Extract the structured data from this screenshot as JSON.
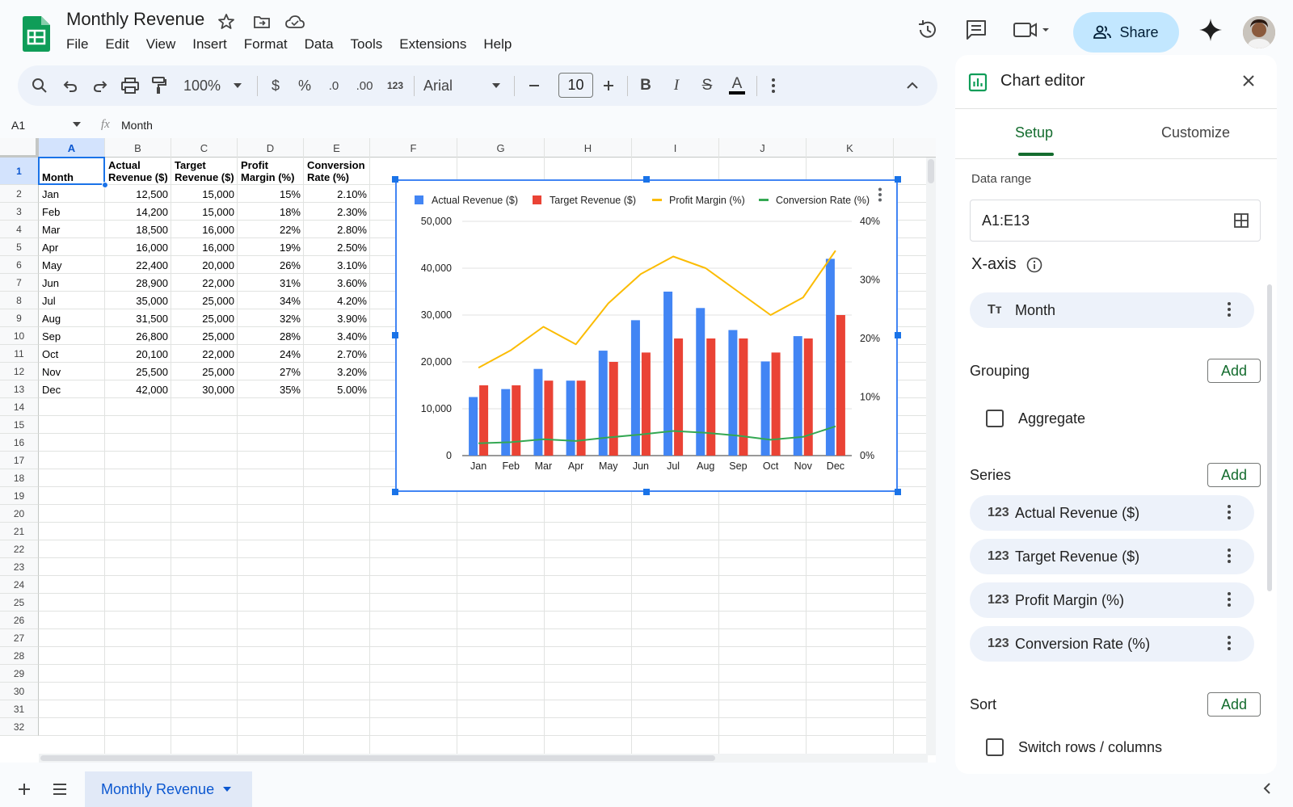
{
  "app": {
    "title": "Monthly Revenue",
    "menu": [
      "File",
      "Edit",
      "View",
      "Insert",
      "Format",
      "Data",
      "Tools",
      "Extensions",
      "Help"
    ],
    "share_label": "Share"
  },
  "toolbar": {
    "zoom": "100%",
    "currency": "$",
    "percent": "%",
    "dec_decrease": ".0",
    "dec_increase": ".00",
    "number_format": "123",
    "font": "Arial",
    "font_size": "10",
    "bold": "B",
    "italic": "I",
    "strike": "S",
    "text_color": "A"
  },
  "formula_bar": {
    "name_box": "A1",
    "fx": "fx",
    "value": "Month"
  },
  "sheet": {
    "columns": [
      "A",
      "B",
      "C",
      "D",
      "E",
      "F",
      "G",
      "H",
      "I",
      "J",
      "K"
    ],
    "row_numbers": [
      "1",
      "2",
      "3",
      "4",
      "5",
      "6",
      "7",
      "8",
      "9",
      "10",
      "11",
      "12",
      "13",
      "14",
      "15",
      "16",
      "17",
      "18",
      "19",
      "20",
      "21",
      "22",
      "23",
      "24",
      "25",
      "26",
      "27",
      "28",
      "29",
      "30",
      "31",
      "32"
    ],
    "headers": [
      "Month",
      "Actual Revenue ($)",
      "Target Revenue ($)",
      "Profit Margin (%)",
      "Conversion Rate (%)"
    ],
    "rows": [
      [
        "Jan",
        "12,500",
        "15,000",
        "15%",
        "2.10%"
      ],
      [
        "Feb",
        "14,200",
        "15,000",
        "18%",
        "2.30%"
      ],
      [
        "Mar",
        "18,500",
        "16,000",
        "22%",
        "2.80%"
      ],
      [
        "Apr",
        "16,000",
        "16,000",
        "19%",
        "2.50%"
      ],
      [
        "May",
        "22,400",
        "20,000",
        "26%",
        "3.10%"
      ],
      [
        "Jun",
        "28,900",
        "22,000",
        "31%",
        "3.60%"
      ],
      [
        "Jul",
        "35,000",
        "25,000",
        "34%",
        "4.20%"
      ],
      [
        "Aug",
        "31,500",
        "25,000",
        "32%",
        "3.90%"
      ],
      [
        "Sep",
        "26,800",
        "25,000",
        "28%",
        "3.40%"
      ],
      [
        "Oct",
        "20,100",
        "22,000",
        "24%",
        "2.70%"
      ],
      [
        "Nov",
        "25,500",
        "25,000",
        "27%",
        "3.20%"
      ],
      [
        "Dec",
        "42,000",
        "30,000",
        "35%",
        "5.00%"
      ]
    ],
    "tab_name": "Monthly Revenue"
  },
  "chart_data": {
    "type": "bar",
    "categories": [
      "Jan",
      "Feb",
      "Mar",
      "Apr",
      "May",
      "Jun",
      "Jul",
      "Aug",
      "Sep",
      "Oct",
      "Nov",
      "Dec"
    ],
    "series": [
      {
        "name": "Actual Revenue ($)",
        "type": "bar",
        "axis": "left",
        "color": "#4285f4",
        "values": [
          12500,
          14200,
          18500,
          16000,
          22400,
          28900,
          35000,
          31500,
          26800,
          20100,
          25500,
          42000
        ]
      },
      {
        "name": "Target Revenue ($)",
        "type": "bar",
        "axis": "left",
        "color": "#ea4335",
        "values": [
          15000,
          15000,
          16000,
          16000,
          20000,
          22000,
          25000,
          25000,
          25000,
          22000,
          25000,
          30000
        ]
      },
      {
        "name": "Profit Margin (%)",
        "type": "line",
        "axis": "right",
        "color": "#fbbc04",
        "values": [
          15,
          18,
          22,
          19,
          26,
          31,
          34,
          32,
          28,
          24,
          27,
          35
        ]
      },
      {
        "name": "Conversion Rate (%)",
        "type": "line",
        "axis": "right",
        "color": "#34a853",
        "values": [
          2.1,
          2.3,
          2.8,
          2.5,
          3.1,
          3.6,
          4.2,
          3.9,
          3.4,
          2.7,
          3.2,
          5.0
        ]
      }
    ],
    "left_axis": {
      "ylim": [
        0,
        50000
      ],
      "ticks": [
        "0",
        "10,000",
        "20,000",
        "30,000",
        "40,000",
        "50,000"
      ]
    },
    "right_axis": {
      "ylim": [
        0,
        40
      ],
      "ticks": [
        "0%",
        "10%",
        "20%",
        "30%",
        "40%"
      ]
    },
    "legend": "top",
    "grid": true
  },
  "editor": {
    "title": "Chart editor",
    "tabs": [
      "Setup",
      "Customize"
    ],
    "active_tab": "Setup",
    "data_range_label": "Data range",
    "data_range": "A1:E13",
    "x_axis_label": "X-axis",
    "x_axis_item": "Month",
    "x_axis_icon": "Tт",
    "grouping_label": "Grouping",
    "aggregate_label": "Aggregate",
    "series_label": "Series",
    "series_items": [
      "Actual Revenue ($)",
      "Target Revenue ($)",
      "Profit Margin (%)",
      "Conversion Rate (%)"
    ],
    "series_icon": "123",
    "sort_label": "Sort",
    "switch_label": "Switch rows / columns",
    "add_label": "Add"
  },
  "colors": {
    "accent": "#146c2e",
    "share_bg": "#c2e7ff",
    "selection": "#1a73e8"
  }
}
